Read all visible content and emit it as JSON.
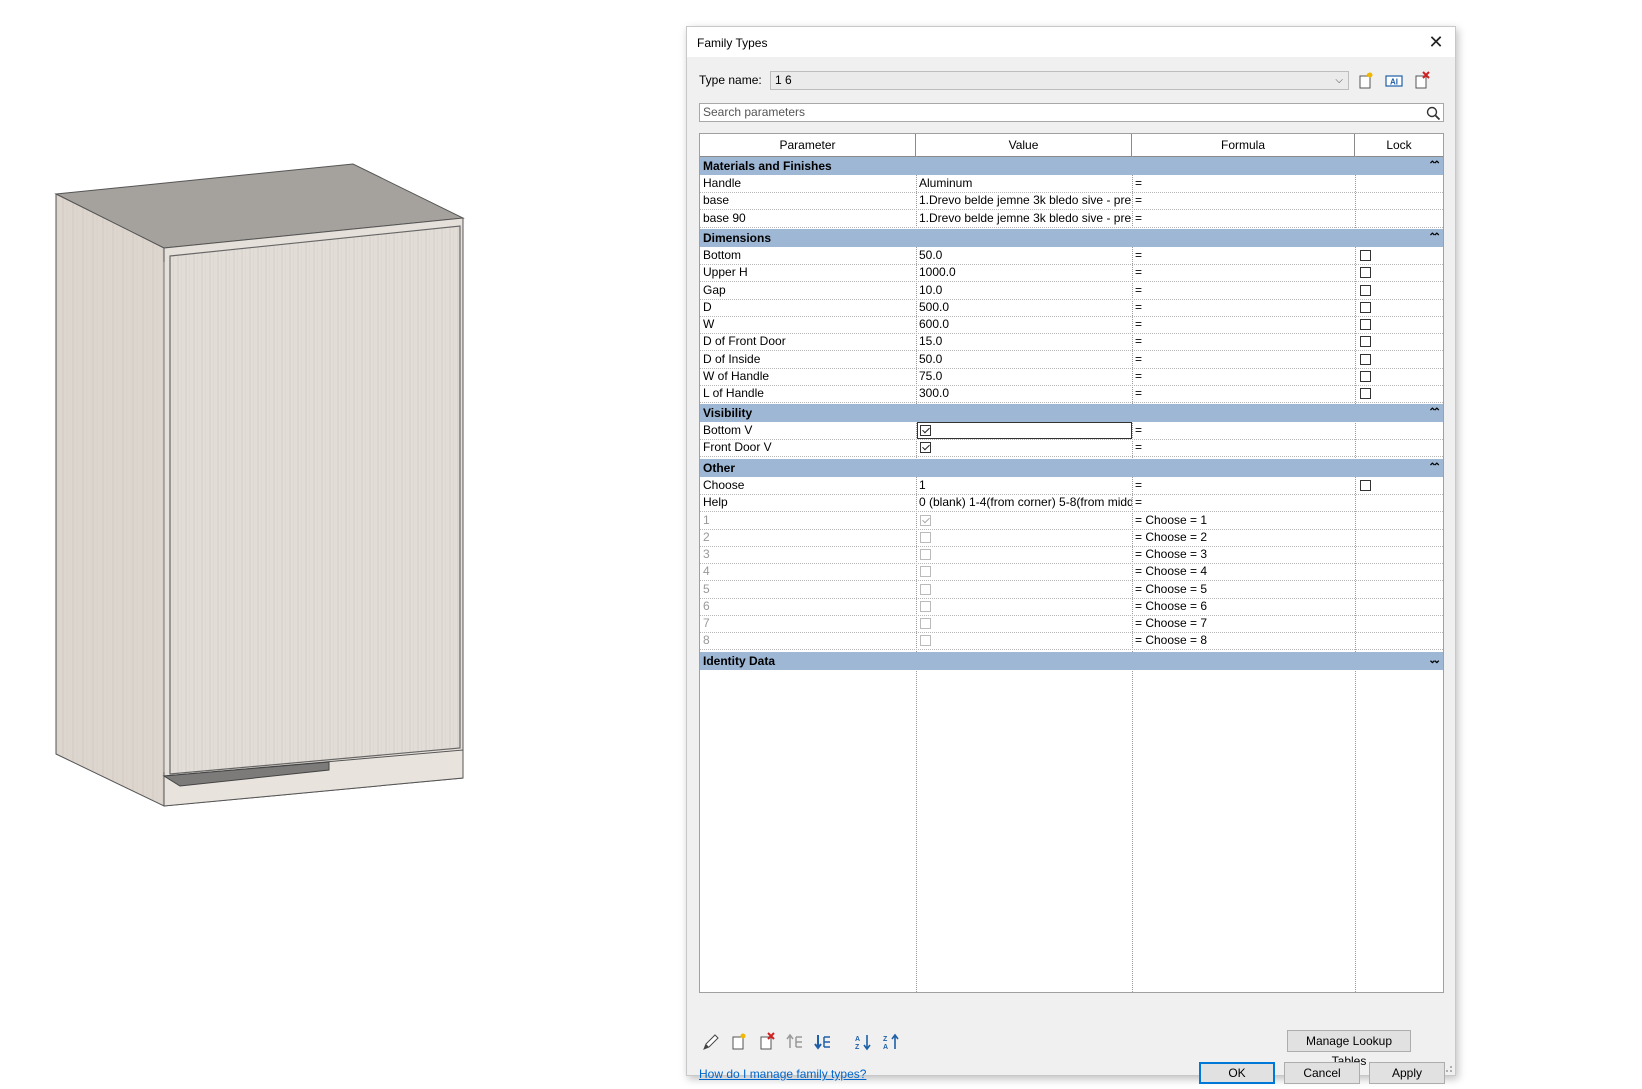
{
  "dialog": {
    "title": "Family Types",
    "type_name_label": "Type name:",
    "type_name_value": "1 6",
    "search_placeholder": "Search parameters"
  },
  "columns": [
    "Parameter",
    "Value",
    "Formula",
    "Lock"
  ],
  "groups": [
    {
      "name": "Materials and Finishes",
      "collapsed": false,
      "rows": [
        {
          "param": "Handle",
          "value": "Aluminum",
          "formula": "=",
          "lock": null
        },
        {
          "param": "base",
          "value": "1.Drevo belde jemne 3k bledo sive - pre",
          "formula": "=",
          "lock": null
        },
        {
          "param": "base 90",
          "value": "1.Drevo belde jemne 3k bledo sive - pre",
          "formula": "=",
          "lock": null
        }
      ]
    },
    {
      "name": "Dimensions",
      "collapsed": false,
      "rows": [
        {
          "param": "Bottom",
          "value": "50.0",
          "formula": "=",
          "lock": false
        },
        {
          "param": "Upper H",
          "value": "1000.0",
          "formula": "=",
          "lock": false
        },
        {
          "param": "Gap",
          "value": "10.0",
          "formula": "=",
          "lock": false
        },
        {
          "param": "D",
          "value": "500.0",
          "formula": "=",
          "lock": false
        },
        {
          "param": "W",
          "value": "600.0",
          "formula": "=",
          "lock": false
        },
        {
          "param": "D of Front Door",
          "value": "15.0",
          "formula": "=",
          "lock": false
        },
        {
          "param": "D of Inside",
          "value": "50.0",
          "formula": "=",
          "lock": false
        },
        {
          "param": "W of Handle",
          "value": "75.0",
          "formula": "=",
          "lock": false
        },
        {
          "param": "L of Handle",
          "value": "300.0",
          "formula": "=",
          "lock": false
        }
      ]
    },
    {
      "name": "Visibility",
      "collapsed": false,
      "rows": [
        {
          "param": "Bottom V",
          "checkbox": true,
          "formula": "=",
          "lock": null,
          "focused": true
        },
        {
          "param": "Front Door V",
          "checkbox": true,
          "formula": "=",
          "lock": null
        }
      ]
    },
    {
      "name": "Other",
      "collapsed": false,
      "rows": [
        {
          "param": "Choose",
          "value": "1",
          "formula": "=",
          "lock": false
        },
        {
          "param": "Help",
          "value": "0 (blank) 1-4(from corner) 5-8(from middl",
          "formula": "=",
          "lock": null
        },
        {
          "param": "1",
          "checkbox": true,
          "formula": "= Choose = 1",
          "lock": null,
          "dim": true
        },
        {
          "param": "2",
          "checkbox": false,
          "formula": "= Choose = 2",
          "lock": null,
          "dim": true
        },
        {
          "param": "3",
          "checkbox": false,
          "formula": "= Choose = 3",
          "lock": null,
          "dim": true
        },
        {
          "param": "4",
          "checkbox": false,
          "formula": "= Choose = 4",
          "lock": null,
          "dim": true
        },
        {
          "param": "5",
          "checkbox": false,
          "formula": "= Choose = 5",
          "lock": null,
          "dim": true
        },
        {
          "param": "6",
          "checkbox": false,
          "formula": "= Choose = 6",
          "lock": null,
          "dim": true
        },
        {
          "param": "7",
          "checkbox": false,
          "formula": "= Choose = 7",
          "lock": null,
          "dim": true
        },
        {
          "param": "8",
          "checkbox": false,
          "formula": "= Choose = 8",
          "lock": null,
          "dim": true
        }
      ]
    },
    {
      "name": "Identity Data",
      "collapsed": true,
      "rows": []
    }
  ],
  "footer": {
    "manage_lookup_label": "Manage Lookup Tables",
    "help_link": "How do I manage family types?",
    "ok_label": "OK",
    "cancel_label": "Cancel",
    "apply_label": "Apply"
  },
  "icons": {
    "new_type": "new-type-icon",
    "rename_type": "rename-type-icon",
    "delete_type": "delete-type-icon",
    "edit_param": "pencil-icon",
    "new_param": "new-parameter-icon",
    "delete_param": "delete-parameter-icon",
    "move_up": "move-up-icon",
    "move_down": "move-down-icon",
    "sort_asc": "sort-ascending-icon",
    "sort_desc": "sort-descending-icon",
    "search": "search-icon"
  },
  "colors": {
    "group_header": "#9db7d5",
    "link": "#0066cc",
    "default_button_border": "#0078d7"
  }
}
